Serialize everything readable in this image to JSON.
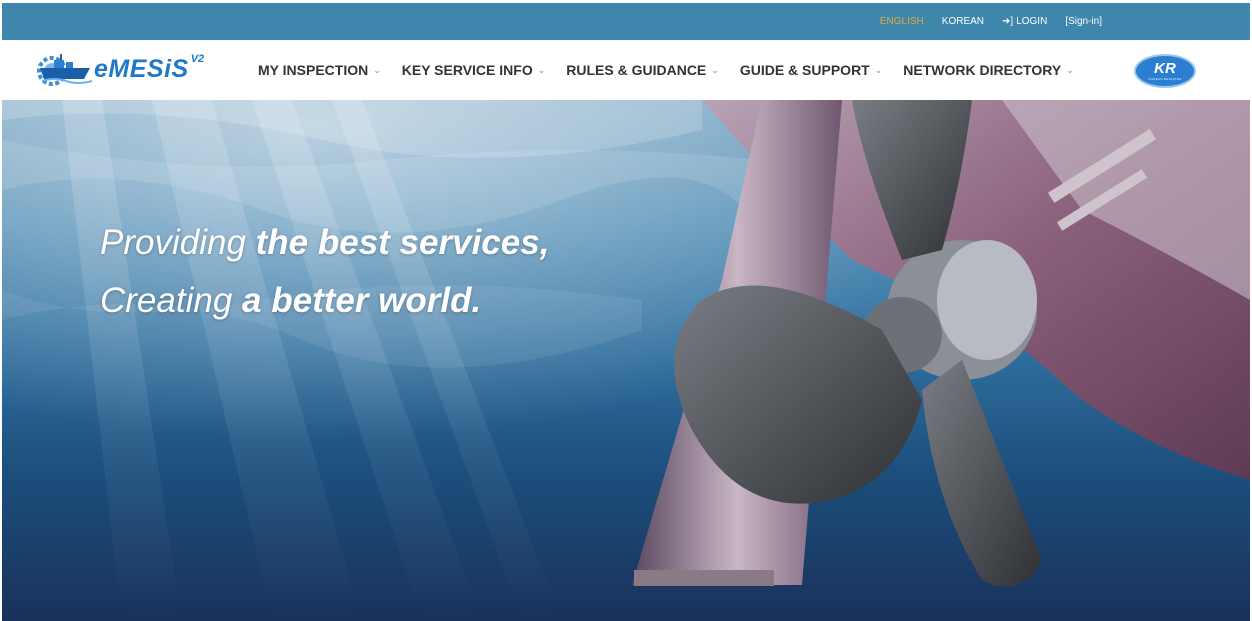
{
  "topbar": {
    "english": "ENGLISH",
    "korean": "KOREAN",
    "login": "LOGIN",
    "signin": "[Sign-in]"
  },
  "logo": {
    "text": "eMESiS",
    "version": "V2"
  },
  "menu": [
    {
      "label": "MY INSPECTION"
    },
    {
      "label": "KEY SERVICE INFO"
    },
    {
      "label": "RULES & GUIDANCE"
    },
    {
      "label": "GUIDE & SUPPORT"
    },
    {
      "label": "NETWORK DIRECTORY"
    }
  ],
  "kr_logo": {
    "text": "KR",
    "sub": "KOREAN REGISTER"
  },
  "hero": {
    "line1_thin": "Providing ",
    "line1_bold": "the best services,",
    "line2_thin": "Creating ",
    "line2_bold": "a better world."
  },
  "colors": {
    "topbar": "#3f86ad",
    "active_language": "#e8a53a",
    "logo_blue": "#1f78c8"
  }
}
